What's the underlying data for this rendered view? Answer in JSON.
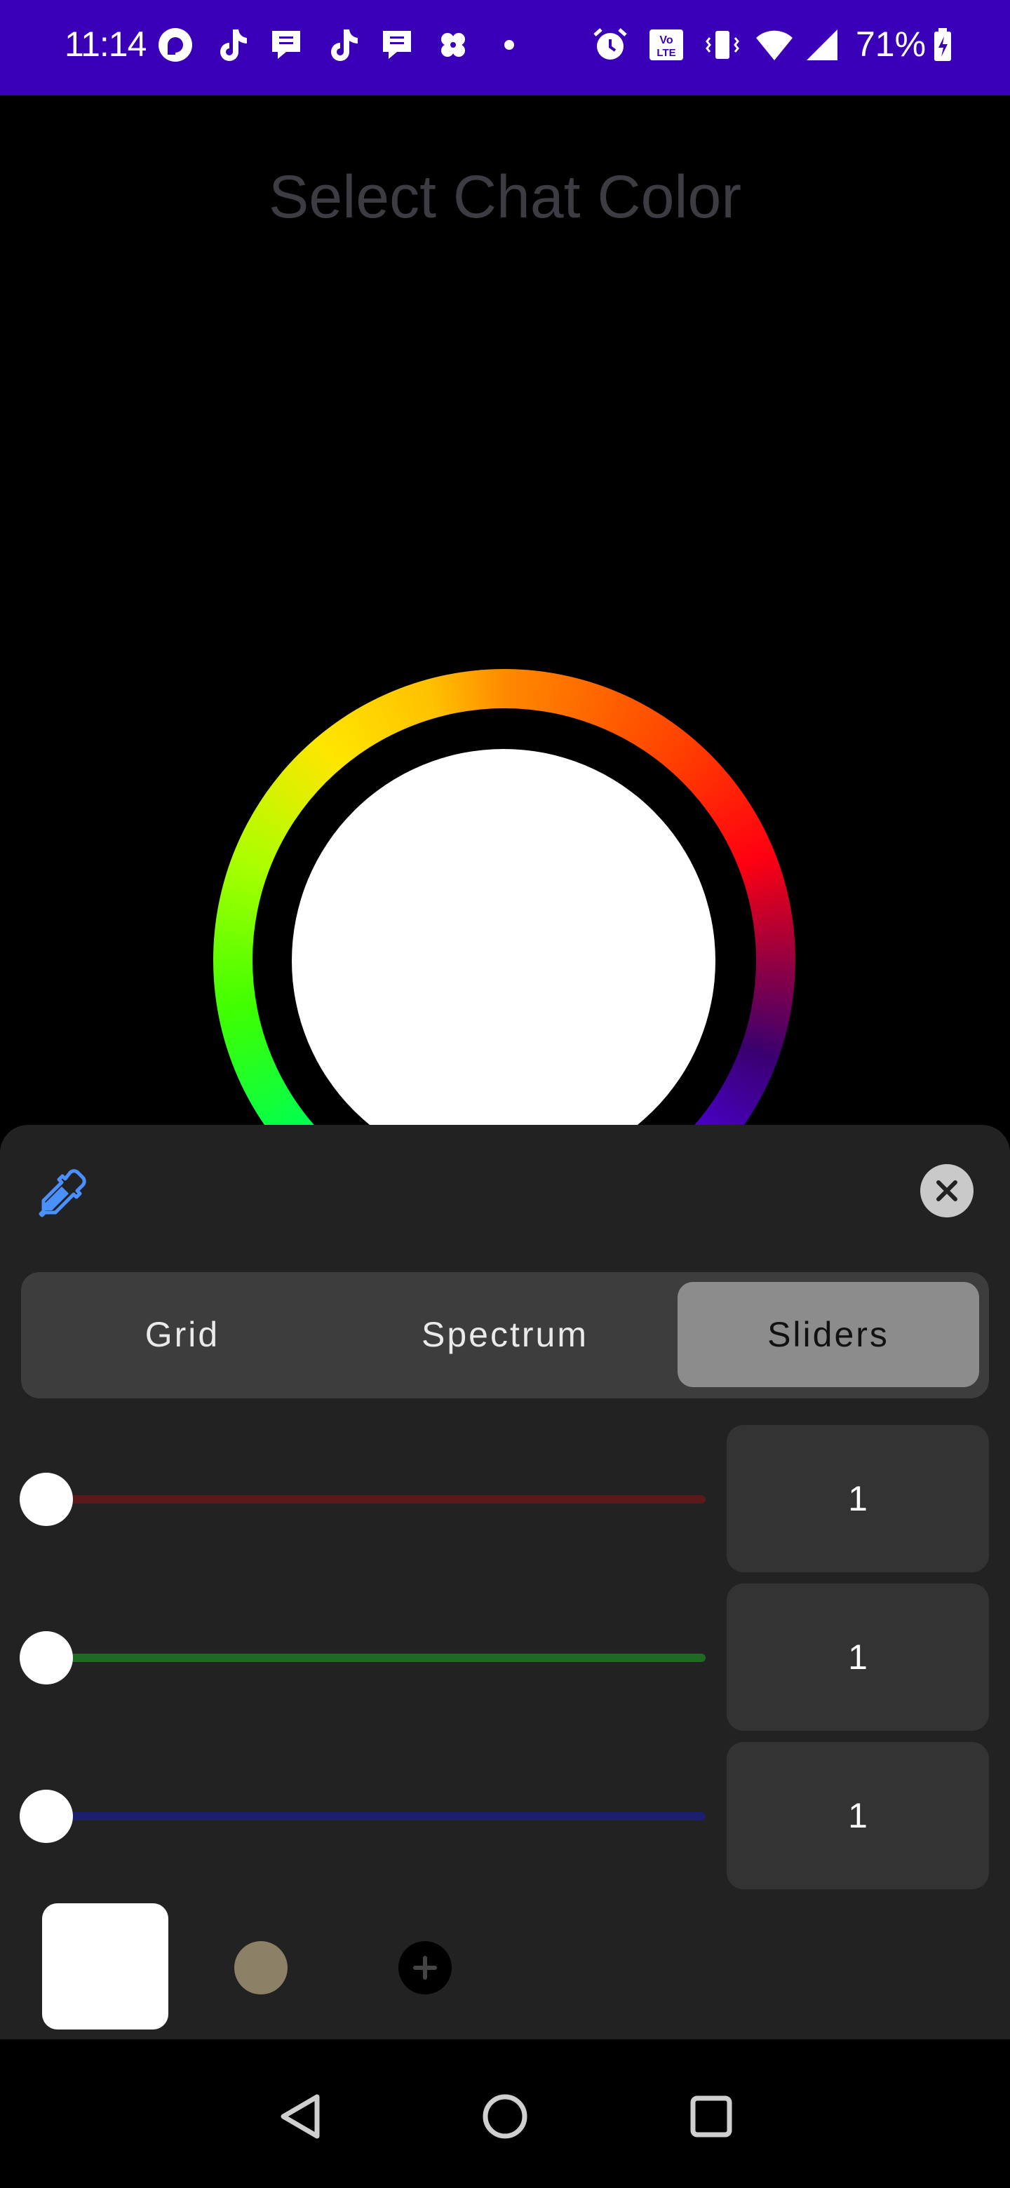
{
  "status_bar": {
    "time": "11:14",
    "battery": "71%",
    "background": "#3a00b8",
    "notification_icons": [
      "pocket-casts-icon",
      "tiktok-icon",
      "chat-bubble-icon",
      "tiktok-icon",
      "chat-bubble-icon",
      "pinwheel-icon",
      "dot-icon"
    ],
    "system_icons": [
      "alarm-icon",
      "volte-icon",
      "vibrate-icon",
      "wifi-icon",
      "signal-icon",
      "battery-charging-icon"
    ]
  },
  "page": {
    "title": "Select Chat Color"
  },
  "color_wheel": {
    "selected_color": "#ffffff"
  },
  "sheet": {
    "eyedropper_icon": "eyedropper-icon",
    "close_icon": "close-icon",
    "tabs": [
      {
        "label": "Grid",
        "active": false
      },
      {
        "label": "Spectrum",
        "active": false
      },
      {
        "label": "Sliders",
        "active": true
      }
    ],
    "sliders": [
      {
        "channel": "red",
        "value": "1",
        "track_color": "#5a1a1a"
      },
      {
        "channel": "green",
        "value": "1",
        "track_color": "#1f6b24"
      },
      {
        "channel": "blue",
        "value": "1",
        "track_color": "#1b1f6e"
      }
    ],
    "swatches": {
      "current_color": "#ffffff",
      "recent_color": "#8c8166",
      "add_icon": "plus-icon"
    }
  },
  "nav_bar": {
    "back_icon": "back-triangle-icon",
    "home_icon": "home-circle-icon",
    "recents_icon": "recents-square-icon"
  },
  "colors": {
    "accent_blue": "#4a90ff",
    "sheet_background": "#222222"
  }
}
